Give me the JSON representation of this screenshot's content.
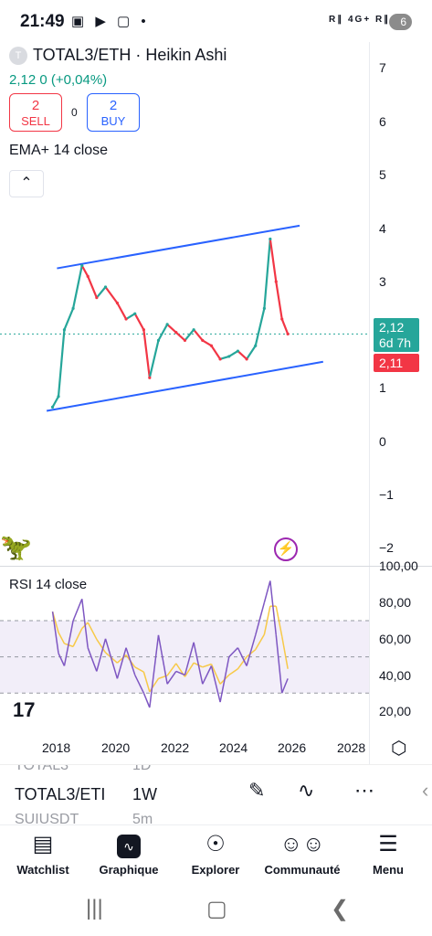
{
  "status_bar": {
    "time": "21:49",
    "left_icons": "▣ ▶ ▢ •",
    "signal": "R∥ 4G+ R∥ R∥",
    "battery": "6"
  },
  "symbol": {
    "logo": "T",
    "title": "TOTAL3/ETH · Heikin Ashi",
    "price_change": "2,12  0 (+0,04%)"
  },
  "trade": {
    "sell_count": "2",
    "sell_label": "SELL",
    "spread": "0",
    "buy_count": "2",
    "buy_label": "BUY"
  },
  "indicator": {
    "label": "EMA+ 14 close",
    "collapse_icon": "chevron-up"
  },
  "price_axis": [
    "7",
    "6",
    "5",
    "4",
    "3",
    "2",
    "1",
    "0",
    "−1",
    "−2"
  ],
  "price_tags": {
    "current": "2,12",
    "countdown": "6d 7h",
    "prev": "2,11"
  },
  "rsi": {
    "label": "RSI 14 close",
    "axis": [
      "100,00",
      "80,00",
      "60,00",
      "40,00",
      "20,00"
    ]
  },
  "x_axis": [
    "2018",
    "2020",
    "2022",
    "2024",
    "2026",
    "2028"
  ],
  "picker": {
    "prev_symbol": "TOTAL3",
    "prev_interval": "1D",
    "symbol": "TOTAL3/ETI",
    "interval": "1W",
    "next_symbol": "SUIUSDT",
    "next_interval": "5m"
  },
  "nav": [
    {
      "label": "Watchlist",
      "icon": "watchlist-icon"
    },
    {
      "label": "Graphique",
      "icon": "chart-icon"
    },
    {
      "label": "Explorer",
      "icon": "compass-icon"
    },
    {
      "label": "Communauté",
      "icon": "community-icon"
    },
    {
      "label": "Menu",
      "icon": "menu-icon"
    }
  ],
  "colors": {
    "up": "#26a69a",
    "down": "#f23645",
    "channel": "#2962ff",
    "rsi": "#7e57c2",
    "rsi_ma": "#f7c948"
  },
  "chart_data": {
    "type": "line",
    "title": "TOTAL3/ETH · Heikin Ashi",
    "x": [
      2017.8,
      2018.0,
      2018.2,
      2018.5,
      2018.8,
      2019.0,
      2019.3,
      2019.6,
      2020.0,
      2020.3,
      2020.6,
      2020.9,
      2021.1,
      2021.4,
      2021.7,
      2022.0,
      2022.3,
      2022.6,
      2022.9,
      2023.2,
      2023.5,
      2023.8,
      2024.1,
      2024.4,
      2024.7,
      2025.0,
      2025.2,
      2025.4,
      2025.6,
      2025.8
    ],
    "series": [
      {
        "values": [
          0.75,
          0.95,
          2.2,
          2.6,
          3.4,
          3.2,
          2.8,
          3.0,
          2.7,
          2.4,
          2.5,
          2.2,
          1.3,
          2.0,
          2.3,
          2.15,
          2.0,
          2.2,
          2.0,
          1.9,
          1.65,
          1.7,
          1.8,
          1.65,
          1.9,
          2.6,
          3.9,
          3.1,
          2.4,
          2.12
        ]
      }
    ],
    "rsi": [
      75,
      52,
      45,
      70,
      82,
      55,
      42,
      60,
      38,
      55,
      40,
      30,
      22,
      62,
      35,
      42,
      40,
      58,
      35,
      45,
      25,
      50,
      55,
      45,
      62,
      80,
      92,
      62,
      30,
      38
    ],
    "ylim": [
      -2,
      7
    ],
    "rsi_ylim": [
      15,
      100
    ]
  }
}
